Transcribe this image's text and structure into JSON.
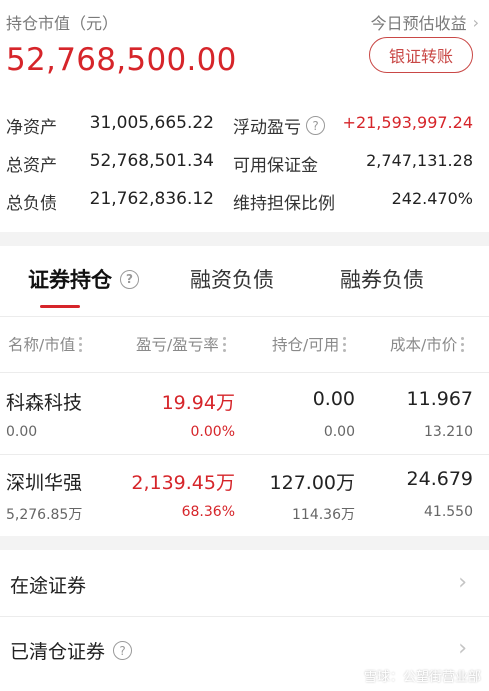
{
  "header": {
    "market_value_label": "持仓市值（元）",
    "today_profit_label": "今日预估收益",
    "market_value": "52,768,500.00",
    "bank_transfer_label": "银证转账"
  },
  "summary": [
    {
      "k1": "净资产",
      "v1": "31,005,665.22",
      "k2": "浮动盈亏",
      "v2": "+21,593,997.24"
    },
    {
      "k1": "总资产",
      "v1": "52,768,501.34",
      "k2": "可用保证金",
      "v2": "2,747,131.28"
    },
    {
      "k1": "总负债",
      "v1": "21,762,836.12",
      "k2": "维持担保比例",
      "v2": "242.470%"
    }
  ],
  "tabs": {
    "holdings": "证券持仓",
    "margin_debt": "融资负债",
    "short_debt": "融券负债"
  },
  "columns": {
    "name": "名称/市值",
    "pl": "盈亏/盈亏率",
    "position": "持仓/可用",
    "cost": "成本/市价"
  },
  "holdings": [
    {
      "name": "科森科技",
      "market_value": "0.00",
      "pl": "19.94万",
      "pl_rate": "0.00%",
      "position": "0.00",
      "available": "0.00",
      "cost": "11.967",
      "price": "13.210"
    },
    {
      "name": "深圳华强",
      "market_value": "5,276.85万",
      "pl": "2,139.45万",
      "pl_rate": "68.36%",
      "position": "127.00万",
      "available": "114.36万",
      "cost": "24.679",
      "price": "41.550"
    }
  ],
  "nav": {
    "in_transit": "在途证券",
    "cleared": "已清仓证券"
  },
  "watermark": "雪球：公望街营业部",
  "colors": {
    "accent_red": "#d6252a",
    "muted": "#8a8a8a"
  }
}
